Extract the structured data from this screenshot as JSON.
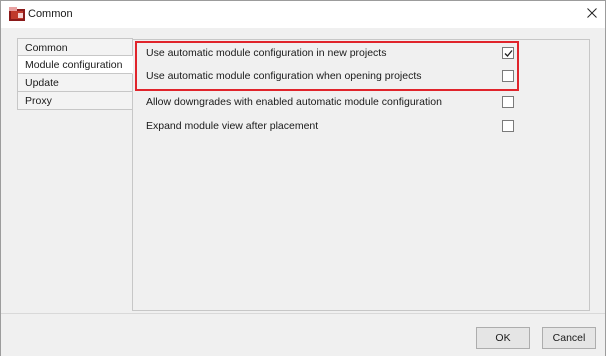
{
  "window": {
    "title": "Common",
    "close_icon": "close-icon",
    "app_icon": "application-icon"
  },
  "nav": {
    "items": [
      {
        "label": "Common",
        "active": false
      },
      {
        "label": "Module configuration",
        "active": true
      },
      {
        "label": "Update",
        "active": false
      },
      {
        "label": "Proxy",
        "active": false
      }
    ]
  },
  "options": [
    {
      "label": "Use automatic module configuration in new projects",
      "checked": true
    },
    {
      "label": "Use automatic module configuration when opening projects",
      "checked": false
    },
    {
      "label": "Allow downgrades with enabled automatic module configuration",
      "checked": false
    },
    {
      "label": "Expand module view after placement",
      "checked": false
    }
  ],
  "footer": {
    "ok_label": "OK",
    "cancel_label": "Cancel"
  },
  "colors": {
    "highlight": "#e0242b",
    "window_bg": "#f0f0f0"
  }
}
